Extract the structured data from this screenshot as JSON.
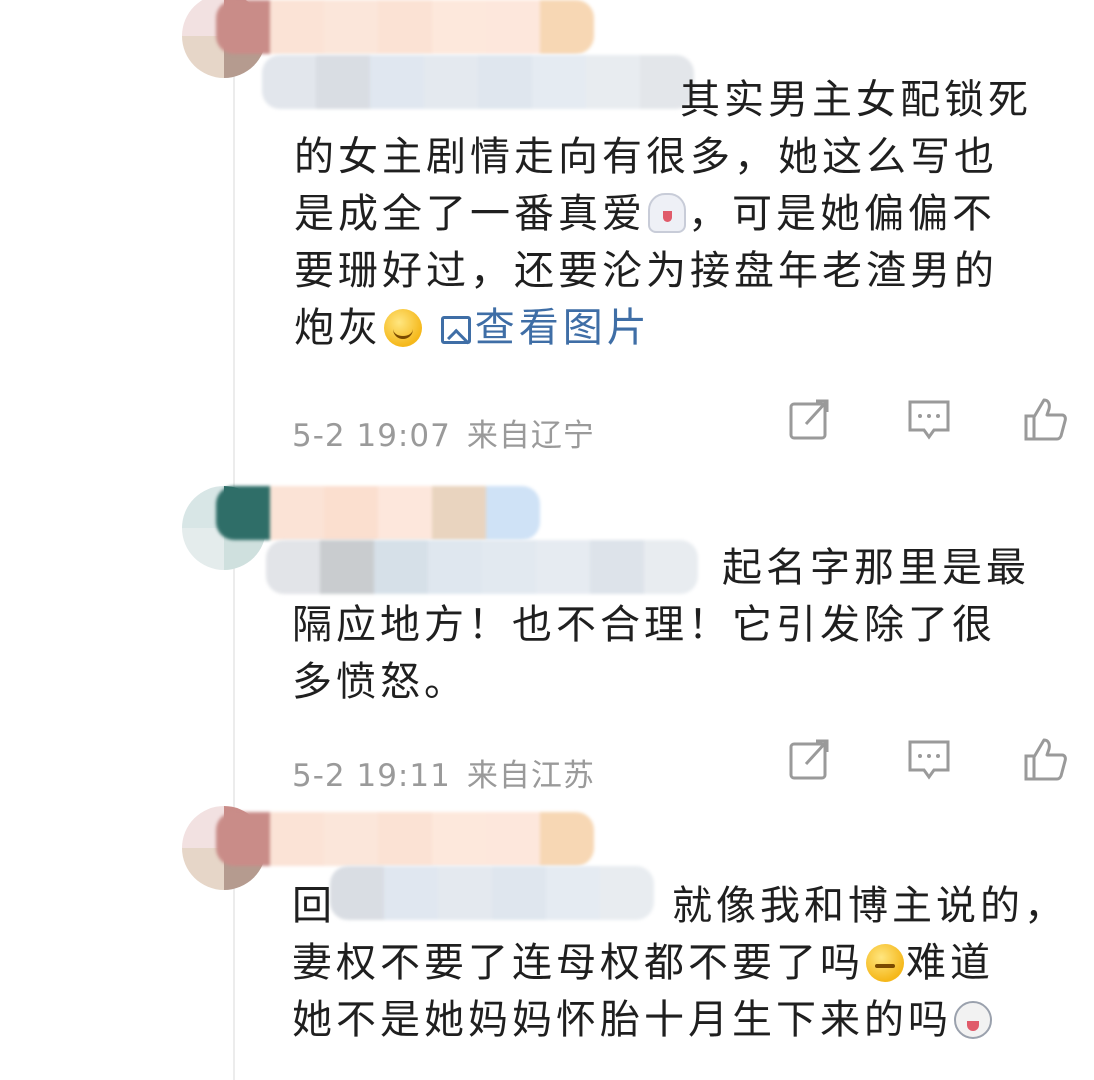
{
  "comments": [
    {
      "text_lines": [
        "其实男主女配锁死",
        "的女主剧情走向有很多，她这么写也",
        "是成全了一番真爱"
      ],
      "text_after_ghost": "，可是她偏偏不",
      "line4": "要珊好过，还要沦为接盘年老渣男的",
      "line5": "炮灰",
      "view_pic_label": "查看图片",
      "time": "5-2 19:07",
      "location": "来自辽宁",
      "emojis": [
        "ghost-emoji",
        "smile-emoji"
      ]
    },
    {
      "text_lines": [
        "起名字那里是最",
        "隔应地方！也不合理！它引发除了很",
        "多愤怒。"
      ],
      "time": "5-2 19:11",
      "location": "来自江苏"
    },
    {
      "text_lines": [
        "回",
        "就像我和博主说的，",
        "妻权不要了连母权都不要了吗",
        "难道",
        "她不是她妈妈怀胎十月生下来的吗"
      ],
      "emojis": [
        "smirk-emoji",
        "dog-emoji"
      ]
    }
  ],
  "icons": {
    "share": "share-icon",
    "reply": "reply-icon",
    "like": "like-icon",
    "picture": "picture-icon"
  },
  "colors": {
    "link": "#3f6ea6",
    "meta": "#9a9a9a",
    "text": "#1f1f1f"
  }
}
